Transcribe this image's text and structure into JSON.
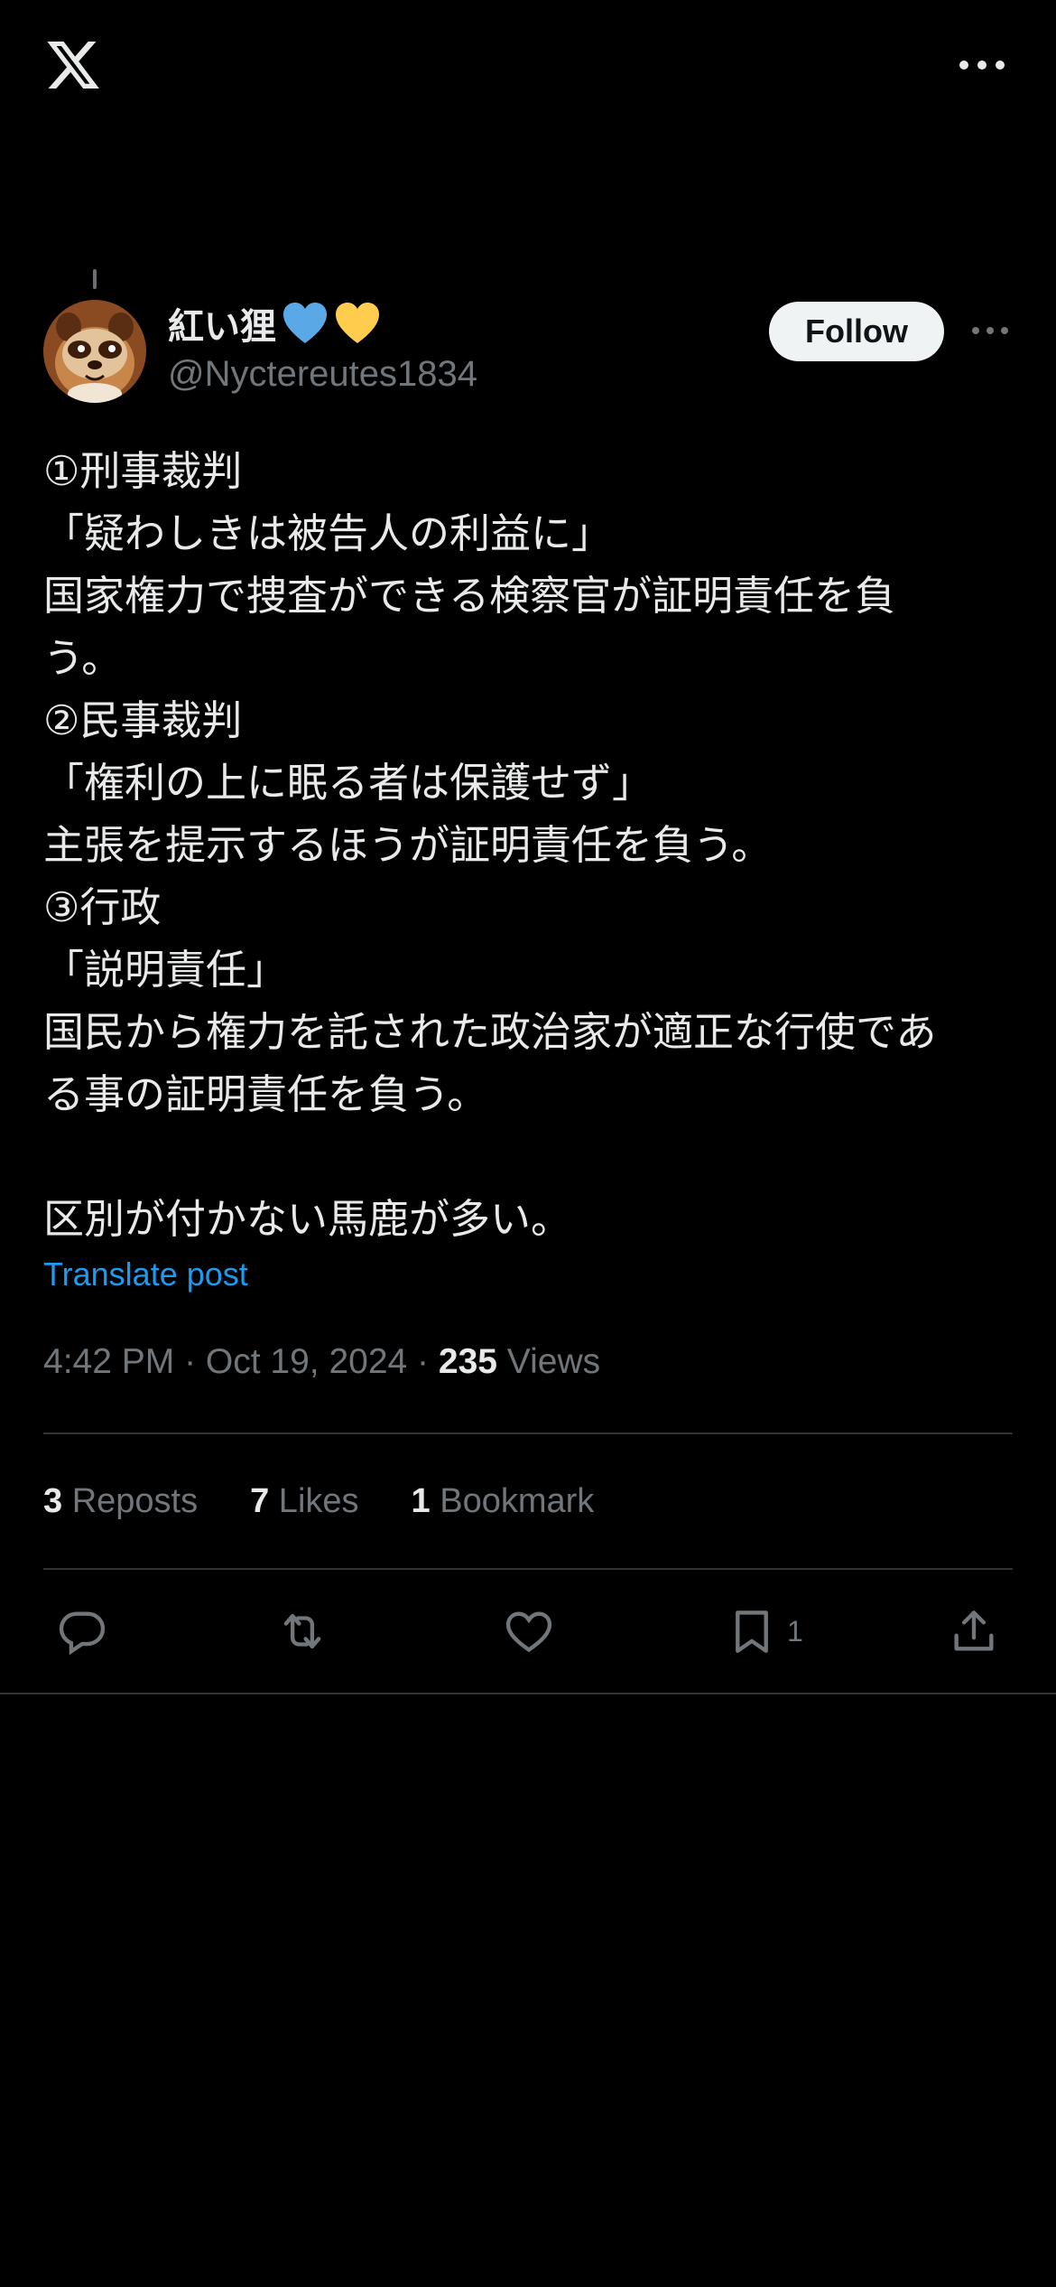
{
  "app": {
    "logo": "x-logo",
    "more_icon": "more-horizontal-icon"
  },
  "author": {
    "name": "紅い狸",
    "emoji": [
      "blue-heart",
      "yellow-heart"
    ],
    "handle": "@Nyctereutes1834",
    "follow_label": "Follow"
  },
  "post": {
    "lines": [
      "①刑事裁判",
      "「疑わしきは被告人の利益に」",
      "国家権力で捜査ができる検察官が証明責任を負",
      "う。",
      "②民事裁判",
      "「権利の上に眠る者は保護せず」",
      "主張を提示するほうが証明責任を負う。",
      "③行政",
      "「説明責任」",
      "国民から権力を託された政治家が適正な行使であ",
      "る事の証明責任を負う。",
      "",
      "区別が付かない馬鹿が多い。"
    ],
    "translate_label": "Translate post",
    "timestamp": "4:42 PM · Oct 19, 2024 · ",
    "views_count": "235",
    "views_label": " Views"
  },
  "stats": {
    "reposts": {
      "count": "3",
      "label": " Reposts"
    },
    "likes": {
      "count": "7",
      "label": " Likes"
    },
    "bookmarks": {
      "count": "1",
      "label": " Bookmark"
    }
  },
  "actions": {
    "reply_icon": "reply-icon",
    "repost_icon": "repost-icon",
    "like_icon": "heart-icon",
    "bookmark_icon": "bookmark-icon",
    "bookmark_count": "1",
    "share_icon": "share-icon"
  },
  "colors": {
    "background": "#000000",
    "text": "#e7e9ea",
    "secondary": "#71767b",
    "link": "#1d9bf0",
    "divider": "#2f3336",
    "blue_heart": "#5aa9e6",
    "yellow_heart": "#ffcc4d"
  }
}
